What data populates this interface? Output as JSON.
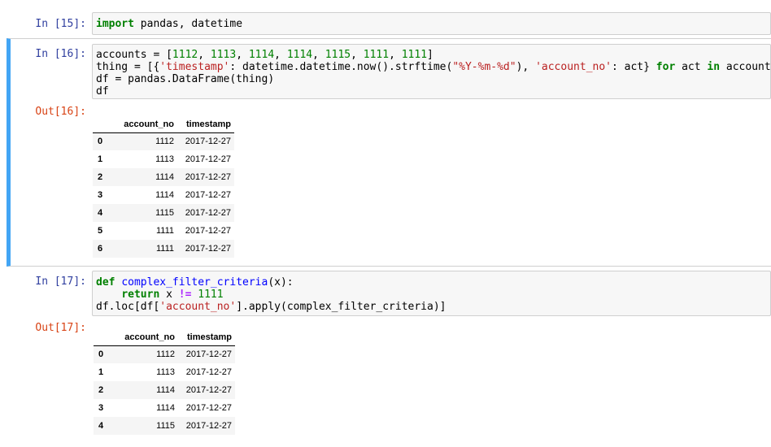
{
  "cells": {
    "c15": {
      "prompt": "In [15]:",
      "line1": {
        "kw": "import",
        "rest": " pandas, datetime"
      }
    },
    "c16": {
      "prompt": "In [16]:",
      "out_prompt": "Out[16]:",
      "l1a": "accounts = [",
      "nums": [
        "1112",
        "1113",
        "1114",
        "1114",
        "1115",
        "1111",
        "1111"
      ],
      "sep": ", ",
      "l1z": "]",
      "l2a": "thing = [{",
      "s_timestamp": "'timestamp'",
      "l2b": ": datetime.datetime.now().strftime(",
      "s_fmt": "\"%Y-%m-%d\"",
      "l2c": "), ",
      "s_account": "'account_no'",
      "l2d": ": act} ",
      "kw_for": "for",
      "l2e": " act ",
      "kw_in": "in",
      "l2f": " accounts]",
      "l3": "df = pandas.DataFrame(thing)",
      "l4": "df"
    },
    "c17": {
      "prompt": "In [17]:",
      "out_prompt": "Out[17]:",
      "kw_def": "def",
      "fn_name": "complex_filter_criteria",
      "l1b": "(x):",
      "indent": "    ",
      "kw_return": "return",
      "l2b": " x ",
      "op_ne": "!=",
      "l2c": " ",
      "num_1111": "1111",
      "l3a": "df.loc[df[",
      "s_account": "'account_no'",
      "l3b": "].apply(complex_filter_criteria)]"
    }
  },
  "table16": {
    "columns": [
      "account_no",
      "timestamp"
    ],
    "rows": [
      {
        "idx": "0",
        "acct": "1112",
        "ts": "2017-12-27"
      },
      {
        "idx": "1",
        "acct": "1113",
        "ts": "2017-12-27"
      },
      {
        "idx": "2",
        "acct": "1114",
        "ts": "2017-12-27"
      },
      {
        "idx": "3",
        "acct": "1114",
        "ts": "2017-12-27"
      },
      {
        "idx": "4",
        "acct": "1115",
        "ts": "2017-12-27"
      },
      {
        "idx": "5",
        "acct": "1111",
        "ts": "2017-12-27"
      },
      {
        "idx": "6",
        "acct": "1111",
        "ts": "2017-12-27"
      }
    ]
  },
  "table17": {
    "columns": [
      "account_no",
      "timestamp"
    ],
    "rows": [
      {
        "idx": "0",
        "acct": "1112",
        "ts": "2017-12-27"
      },
      {
        "idx": "1",
        "acct": "1113",
        "ts": "2017-12-27"
      },
      {
        "idx": "2",
        "acct": "1114",
        "ts": "2017-12-27"
      },
      {
        "idx": "3",
        "acct": "1114",
        "ts": "2017-12-27"
      },
      {
        "idx": "4",
        "acct": "1115",
        "ts": "2017-12-27"
      }
    ]
  },
  "colors": {
    "selected_bar": "#42a5f5",
    "in_prompt": "#303f9f",
    "out_prompt": "#d84315",
    "keyword": "#008000",
    "string": "#ba2121"
  }
}
